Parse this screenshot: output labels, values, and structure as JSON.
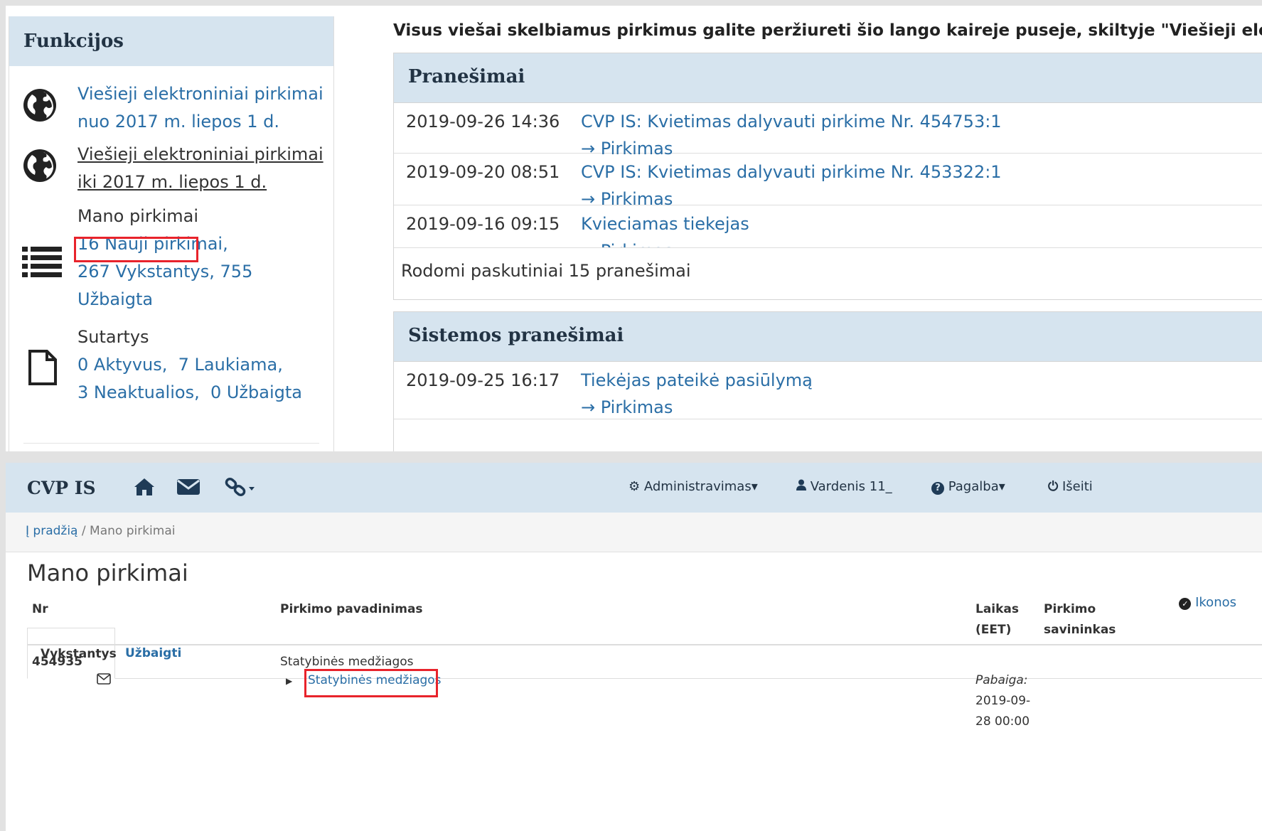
{
  "top": {
    "sidebar": {
      "heading": "Funkcijos",
      "public_new": {
        "line1": "Viešieji elektroniniai pirkimai",
        "line2": "nuo 2017 m. liepos 1 d.",
        "icon": "globe-icon"
      },
      "public_old": {
        "line1": "Viešieji elektroniniai pirkimai",
        "line2": "iki 2017 m. liepos 1 d.",
        "icon": "globe-icon"
      },
      "my_purchases": {
        "label": "Mano pirkimai",
        "icon": "list-icon",
        "new": "16 Nauji pirkimai,",
        "ongoing": "267 Vykstantys,",
        "finished_count": "755",
        "finished_label": "Užbaigta"
      },
      "contracts": {
        "label": "Sutartys",
        "icon": "file-icon",
        "active": "0 Aktyvus,",
        "waiting": "7 Laukiama,",
        "inactive": "3 Neaktualios,",
        "finished": "0 Užbaigta"
      }
    },
    "intro": "Visus viešai skelbiamus pirkimus galite peržiureti šio lango kaireje puseje, skiltyje \"Viešieji elektron",
    "notifications": {
      "heading": "Pranešimai",
      "rows": [
        {
          "date": "2019-09-26 14:36",
          "title": "CVP IS: Kvietimas dalyvauti pirkime Nr. 454753:1",
          "sub": "→ Pirkimas"
        },
        {
          "date": "2019-09-20 08:51",
          "title": "CVP IS: Kvietimas dalyvauti pirkime Nr. 453322:1",
          "sub": "→ Pirkimas"
        },
        {
          "date": "2019-09-16 09:15",
          "title": "Kvieciamas tiekejas",
          "sub": "→ Pirkimas"
        }
      ],
      "footer": "Rodomi paskutiniai 15 pranešimai"
    },
    "system_notifications": {
      "heading": "Sistemos pranešimai",
      "rows": [
        {
          "date": "2019-09-25 16:17",
          "title": "Tiekėjas pateikė pasiūlymą",
          "sub": "→ Pirkimas"
        }
      ]
    }
  },
  "bottom": {
    "nav": {
      "brand": "CVP IS",
      "admin": "Administravimas",
      "user": "Vardenis 11_",
      "help": "Pagalba",
      "logout": "Išeiti"
    },
    "breadcrumb": {
      "home": "Į pradžią",
      "sep": " / ",
      "current": "Mano pirkimai"
    },
    "title": "Mano pirkimai",
    "icons_toggle": "Ikonos",
    "tabs": [
      "Vykstantys",
      "Užbaigti"
    ],
    "table": {
      "headers": {
        "nr": "Nr",
        "name": "Pirkimo pavadinimas",
        "time1": "Laikas",
        "time2": "(EET)",
        "owner1": "Pirkimo",
        "owner2": "savininkas"
      },
      "rows": [
        {
          "nr": "454935",
          "name": "Statybinės medžiagos",
          "lot": "Statybinės medžiagos",
          "end_label": "Pabaiga:",
          "end1": "2019-09-",
          "end2": "28 00:00"
        }
      ]
    }
  },
  "colors": {
    "accent": "#2a6ea6",
    "panel_header": "#d6e4ef",
    "highlight": "#e8232b"
  }
}
